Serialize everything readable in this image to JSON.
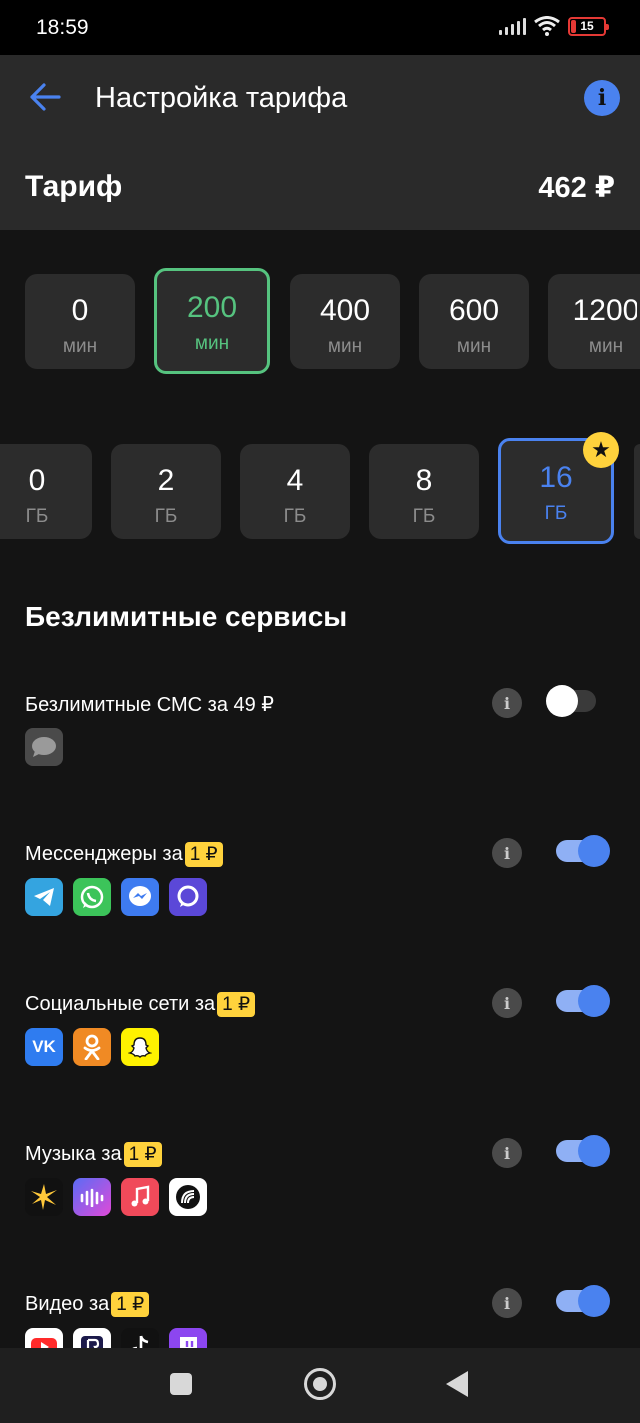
{
  "status": {
    "time": "18:59",
    "battery": "15"
  },
  "header": {
    "title": "Настройка тарифа",
    "tariff_label": "Тариф",
    "tariff_price": "462 ₽"
  },
  "minutes": [
    {
      "value": "0",
      "unit": "мин"
    },
    {
      "value": "200",
      "unit": "мин",
      "selected": true
    },
    {
      "value": "400",
      "unit": "мин"
    },
    {
      "value": "600",
      "unit": "мин"
    },
    {
      "value": "1200",
      "unit": "мин"
    }
  ],
  "gigabytes": [
    {
      "value": "0",
      "unit": "ГБ"
    },
    {
      "value": "2",
      "unit": "ГБ"
    },
    {
      "value": "4",
      "unit": "ГБ"
    },
    {
      "value": "8",
      "unit": "ГБ"
    },
    {
      "value": "16",
      "unit": "ГБ",
      "selected": true,
      "starred": true
    }
  ],
  "section": {
    "title": "Безлимитные сервисы"
  },
  "services": [
    {
      "name": "Безлимитные СМС за 49 ₽",
      "badge": "",
      "enabled": false,
      "apps": [
        "sms-icon"
      ]
    },
    {
      "name": "Мессенджеры за",
      "badge": "1 ₽",
      "enabled": true,
      "apps": [
        "telegram-icon",
        "whatsapp-icon",
        "messenger-icon",
        "viber-icon"
      ]
    },
    {
      "name": "Социальные сети за",
      "badge": "1 ₽",
      "enabled": true,
      "apps": [
        "vk-icon",
        "odnoklassniki-icon",
        "snapchat-icon"
      ]
    },
    {
      "name": "Музыка за",
      "badge": "1 ₽",
      "enabled": true,
      "apps": [
        "zvuk-icon",
        "vk-music-icon",
        "apple-music-icon",
        "yandex-music-icon"
      ]
    },
    {
      "name": "Видео за",
      "badge": "1 ₽",
      "enabled": true,
      "apps": [
        "youtube-icon",
        "rutube-icon",
        "tiktok-icon",
        "twitch-icon"
      ]
    }
  ],
  "colors": {
    "accent_blue": "#4a82ef",
    "selected_green": "#56c37f",
    "badge_yellow": "#ffd23c"
  }
}
